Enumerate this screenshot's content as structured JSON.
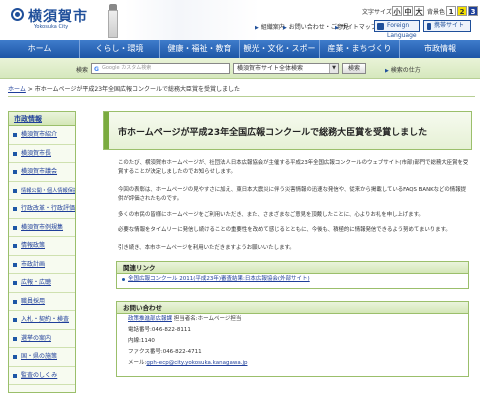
{
  "header": {
    "logo_title": "横須賀市",
    "logo_subtitle": "Yokosuka City",
    "font_size": {
      "label": "文字サイズ",
      "sizes": [
        "小",
        "中",
        "大"
      ]
    },
    "bg_color": {
      "label": "背景色",
      "options": [
        "1",
        "2",
        "3"
      ]
    },
    "links": [
      "組織案内",
      "お問い合わせ・ご意見",
      "サイトマップ"
    ],
    "foreign_language_label": "Foreign Language",
    "mobile_label": "携帯サイト"
  },
  "nav": {
    "items": [
      "ホーム",
      "くらし・環境",
      "健康・福祉・教育",
      "観光・文化・スポーツ",
      "産業・まちづくり",
      "市政情報"
    ]
  },
  "search": {
    "label": "検索",
    "placeholder": "Google カスタム検索",
    "scope": "横須賀市サイト全体検索",
    "button": "検索",
    "help_link": "検索の仕方"
  },
  "breadcrumb": {
    "home": "ホーム",
    "current": "市ホームページが平成23年全国広報コンクールで総務大臣賞を受賞しました"
  },
  "sidebar": {
    "heading": "市政情報",
    "items": [
      "横須賀市紹介",
      "横須賀市長",
      "横須賀市議会",
      "情報公開・個人情報保護",
      "行政改革・行政評価",
      "横須賀市例規集",
      "情報政策",
      "市政計画",
      "広報・広聴",
      "職員採用",
      "入札・契約・検査",
      "選挙の案内",
      "国・県の施策",
      "監査のしくみ"
    ]
  },
  "main": {
    "title": "市ホームページが平成23年全国広報コンクールで総務大臣賞を受賞しました",
    "paragraphs": [
      "このたび、横須賀市ホームページが、社団法人日本広報協会が主催する平成23年全国広報コンクールのウェブサイト(市部)部門で総務大臣賞を受賞することが決定しましたのでお知らせします。",
      "今回の表彰は、ホームページの見やすさに加え、東日本大震災に伴う災害情報の迅速な発信や、従来から掲載しているFAQS BANKなどの情報提供が評価されたものです。",
      "多くの市民の皆様にホームページをご利用いただき、また、さまざまなご意見を頂戴したことに、心よりお礼を申し上げます。",
      "必要な情報をタイムリーに発信し続けることの重要性を改めて感じるとともに、今後も、積極的に情報発信できるよう努めてまいります。",
      "引き続き、本市ホームページを利用いただきますようお願いいたします。"
    ],
    "related": {
      "heading": "関連リンク",
      "link": "全国広報コンクール 2011(平成23年)審査結果:日本広報協会(外部サイト)"
    },
    "contact": {
      "heading": "お問い合わせ",
      "department_link": "政策推進部広報課",
      "department_rest": " 担当者名:ホームページ担当",
      "phone": "電話番号:046-822-8111",
      "extension": "内線:1140",
      "fax": "ファクス番号:046-822-4711",
      "mail_label": "メール:",
      "mail": "gph-ecp@city.yokosuka.kanagawa.jp"
    }
  },
  "colors": {
    "nav_blue": "#1d56a6",
    "accent_green": "#9bbf6b",
    "link_blue": "#1f3f9a"
  }
}
